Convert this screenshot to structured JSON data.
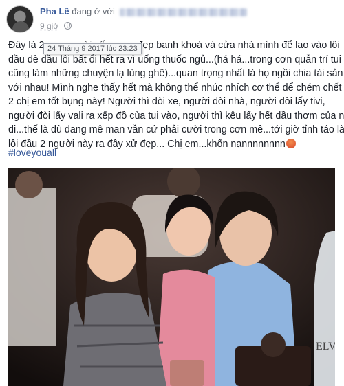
{
  "post": {
    "author": "Pha Lê",
    "status_text": "đang ở với",
    "time": "9 giờ",
    "tooltip": "24 Tháng 9 2017 lúc 23:23",
    "lines": [
      "Đây là 2 con người sống nay đẹp banh khoá và cửa nhà mình để lao vào lôi",
      "đầu đè đầu lôi bất ổi hết ra vì uống thuốc ngủ...(há há...trong cơn quẫn trí tui",
      "cũng làm những chuyện lạ lùng ghê)...quan trọng nhất là họ ngồi chia tài sản",
      "với nhau! Mình nghe thấy hết mà không thể nhúc nhích cơ thể để chém chết",
      "2 chị em tốt bụng này! Người thì đòi xe, người đòi nhà, người đòi lấy tivi,",
      "người đòi lấy vali ra xếp đồ của tui vào, người thì kêu lấy hết dầu thơm của nó",
      "đi...thế là dù đang mê man vẫn cứ phải cười trong cơn mê...tới giờ tỉnh táo là",
      "lôi đầu 2 người này ra đây xử đẹp... Chị em...khốn nạnnnnnnnn"
    ],
    "hashtag": "#loveyouall",
    "icons": {
      "privacy": "globe-icon",
      "emoji": "angry-face-icon",
      "avatar": "profile-avatar"
    },
    "bottle_text": "ELVED",
    "colors": {
      "link": "#365899",
      "meta": "#90949c",
      "text": "#1d2129"
    }
  }
}
